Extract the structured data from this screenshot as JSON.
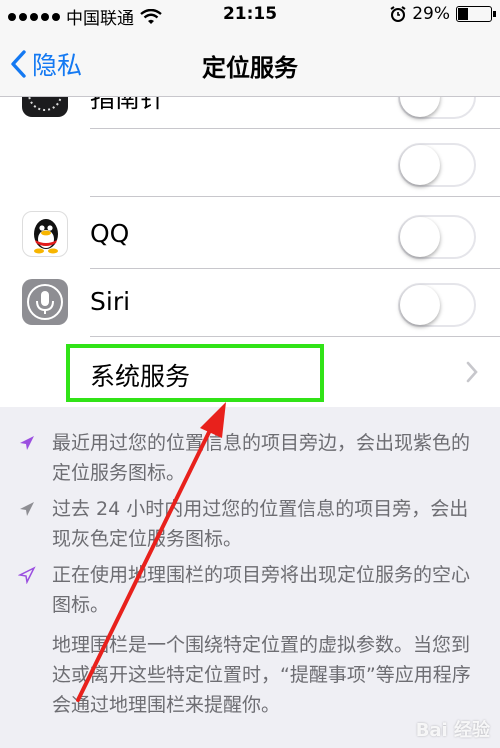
{
  "status_bar": {
    "carrier": "中国联通",
    "time": "21:15",
    "battery": "29%",
    "battery_level": 0.29
  },
  "nav": {
    "back_label": "隐私",
    "title": "定位服务"
  },
  "rows": [
    {
      "label": "指南针",
      "toggle_on": false
    },
    {
      "label": "",
      "toggle_on": false
    },
    {
      "label": "QQ",
      "toggle_on": false
    },
    {
      "label": "Siri",
      "toggle_on": false
    },
    {
      "label": "系统服务"
    }
  ],
  "footer": {
    "note1": "最近用过您的位置信息的项目旁边，会出现紫色的定位服务图标。",
    "note2": "过去 24 小时内用过您的位置信息的项目旁，会出现灰色定位服务图标。",
    "note3": "正在使用地理围栏的项目旁将出现定位服务的空心图标。",
    "note4": "地理围栏是一个围绕特定位置的虚拟参数。当您到达或离开这些特定位置时，“提醒事项”等应用程序会通过地理围栏来提醒你。"
  },
  "watermark": "Bai 经验",
  "colors": {
    "accent": "#1479f2",
    "purple": "#9b4fe0",
    "gray": "#8e8e93",
    "highlight": "#31e317",
    "arrow": "#e8211c"
  }
}
